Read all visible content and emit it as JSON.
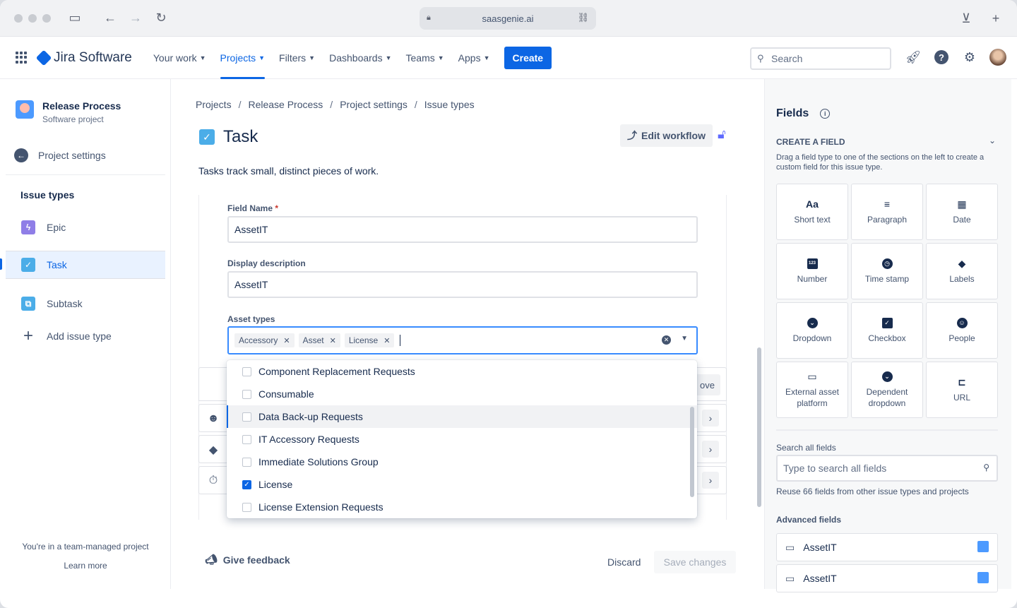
{
  "browser": {
    "url": "saasgenie.ai"
  },
  "nav": {
    "logo": "Jira Software",
    "items": [
      {
        "label": "Your work"
      },
      {
        "label": "Projects"
      },
      {
        "label": "Filters"
      },
      {
        "label": "Dashboards"
      },
      {
        "label": "Teams"
      },
      {
        "label": "Apps"
      }
    ],
    "create": "Create",
    "search_placeholder": "Search"
  },
  "sidebar": {
    "project_name": "Release Process",
    "project_type": "Software project",
    "settings": "Project settings",
    "section_title": "Issue types",
    "items": [
      {
        "label": "Epic"
      },
      {
        "label": "Task"
      },
      {
        "label": "Subtask"
      },
      {
        "label": "Add issue type"
      }
    ],
    "team_note": "You're in a team-managed project",
    "learn_more": "Learn more"
  },
  "content": {
    "breadcrumb": [
      "Projects",
      "Release Process",
      "Project settings",
      "Issue types"
    ],
    "title": "Task",
    "edit_workflow": "Edit workflow",
    "description": "Tasks track small, distinct pieces of work.",
    "field_name_label": "Field Name",
    "field_name_value": "AssetIT",
    "display_desc_label": "Display description",
    "display_desc_value": "AssetIT",
    "asset_types_label": "Asset types",
    "tags": [
      "Accessory",
      "Asset",
      "License"
    ],
    "hidden_btn": "ove",
    "options": [
      {
        "label": "Component Replacement Requests",
        "checked": false
      },
      {
        "label": "Consumable",
        "checked": false
      },
      {
        "label": "Data Back-up Requests",
        "checked": false
      },
      {
        "label": "IT Accessory Requests",
        "checked": false
      },
      {
        "label": "Immediate Solutions Group",
        "checked": false
      },
      {
        "label": "License",
        "checked": true
      },
      {
        "label": "License Extension Requests",
        "checked": false
      }
    ],
    "feedback": "Give feedback",
    "discard": "Discard",
    "save": "Save changes"
  },
  "panel": {
    "title": "Fields",
    "create_field": "CREATE A FIELD",
    "create_desc": "Drag a field type to one of the sections on the left to create a custom field for this issue type.",
    "tiles": [
      {
        "label": "Short text",
        "icon": "Aa"
      },
      {
        "label": "Paragraph",
        "icon": "≡"
      },
      {
        "label": "Date",
        "icon": "▦"
      },
      {
        "label": "Number",
        "icon": "123"
      },
      {
        "label": "Time stamp",
        "icon": "◷"
      },
      {
        "label": "Labels",
        "icon": "◆"
      },
      {
        "label": "Dropdown",
        "icon": "⌄"
      },
      {
        "label": "Checkbox",
        "icon": "✓"
      },
      {
        "label": "People",
        "icon": "☺"
      },
      {
        "label": "External asset platform",
        "icon": "▭"
      },
      {
        "label": "Dependent dropdown",
        "icon": "⌄"
      },
      {
        "label": "URL",
        "icon": "⊏"
      }
    ],
    "search_label": "Search all fields",
    "search_placeholder": "Type to search all fields",
    "reuse": "Reuse 66 fields from other issue types and projects",
    "advanced_title": "Advanced fields",
    "advanced": [
      {
        "label": "AssetIT"
      },
      {
        "label": "AssetIT"
      }
    ]
  }
}
